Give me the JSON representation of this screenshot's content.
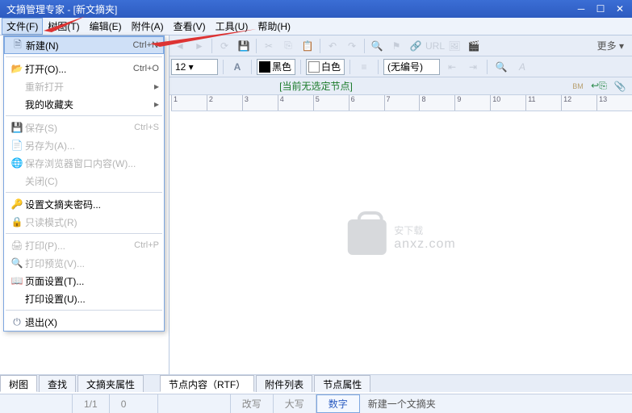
{
  "titlebar": {
    "title": "文摘管理专家 - [新文摘夹]"
  },
  "menubar": {
    "items": [
      {
        "label": "文件(F)"
      },
      {
        "label": "树图(T)"
      },
      {
        "label": "编辑(E)"
      },
      {
        "label": "附件(A)"
      },
      {
        "label": "查看(V)"
      },
      {
        "label": "工具(U)"
      },
      {
        "label": "帮助(H)"
      }
    ]
  },
  "toolbar2": {
    "font_size": "12 ▾",
    "color1": "黑色",
    "color2": "白色",
    "numbering": "(无编号)",
    "more": "更多 ▾"
  },
  "headerbar": {
    "text": "[当前无选定节点]"
  },
  "filemenu": [
    {
      "icon": "file-new-icon",
      "label": "新建(N)",
      "shortcut": "Ctrl+N",
      "hl": true
    },
    {
      "sep": true
    },
    {
      "icon": "folder-open-icon",
      "label": "打开(O)...",
      "shortcut": "Ctrl+O"
    },
    {
      "icon": "",
      "label": "重新打开",
      "arrow": true,
      "dis": true
    },
    {
      "icon": "",
      "label": "我的收藏夹",
      "arrow": true
    },
    {
      "sep": true
    },
    {
      "icon": "save-icon",
      "label": "保存(S)",
      "shortcut": "Ctrl+S",
      "dis": true
    },
    {
      "icon": "saveas-icon",
      "label": "另存为(A)...",
      "dis": true
    },
    {
      "icon": "browser-icon",
      "label": "保存浏览器窗口内容(W)...",
      "dis": true
    },
    {
      "icon": "",
      "label": "关闭(C)",
      "dis": true
    },
    {
      "sep": true
    },
    {
      "icon": "key-icon",
      "label": "设置文摘夹密码..."
    },
    {
      "icon": "readonly-icon",
      "label": "只读模式(R)",
      "dis": true
    },
    {
      "sep": true
    },
    {
      "icon": "print-icon",
      "label": "打印(P)...",
      "shortcut": "Ctrl+P",
      "dis": true
    },
    {
      "icon": "preview-icon",
      "label": "打印预览(V)...",
      "dis": true
    },
    {
      "icon": "page-setup-icon",
      "label": "页面设置(T)..."
    },
    {
      "icon": "",
      "label": "打印设置(U)..."
    },
    {
      "sep": true
    },
    {
      "icon": "exit-icon",
      "label": "退出(X)"
    }
  ],
  "bottom_tabs": {
    "left": [
      {
        "label": "树图"
      },
      {
        "label": "查找"
      },
      {
        "label": "文摘夹属性"
      }
    ],
    "right": [
      {
        "label": "节点内容（RTF）"
      },
      {
        "label": "附件列表"
      },
      {
        "label": "节点属性"
      }
    ]
  },
  "statusbar": {
    "cells": [
      "",
      "1/1",
      "0",
      "",
      "改写",
      "大写",
      "数字"
    ],
    "msg": "新建一个文摘夹"
  },
  "watermark": {
    "main": "安下载",
    "url": "anxz.com"
  },
  "ruler_ticks": [
    "1",
    "2",
    "3",
    "4",
    "5",
    "6",
    "7",
    "8",
    "9",
    "10",
    "11",
    "12",
    "13"
  ]
}
